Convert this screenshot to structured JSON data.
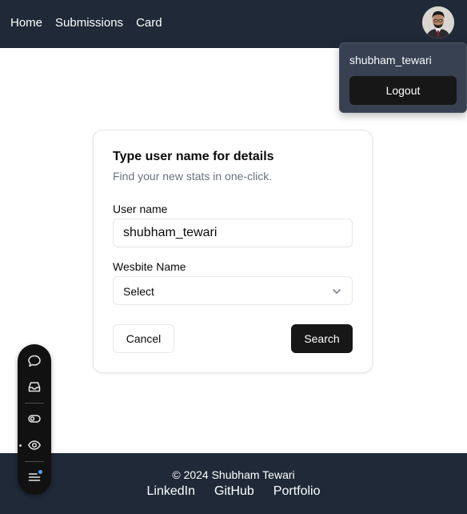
{
  "nav": {
    "links": [
      "Home",
      "Submissions",
      "Card"
    ]
  },
  "user_menu": {
    "username": "shubham_tewari",
    "logout_label": "Logout"
  },
  "card": {
    "title": "Type user name for details",
    "description": "Find your new stats in one-click.",
    "username_label": "User name",
    "username_value": "shubham_tewari",
    "website_label": "Wesbite Name",
    "website_selected": "Select",
    "cancel_label": "Cancel",
    "search_label": "Search"
  },
  "footer": {
    "copyright": "© 2024 Shubham Tewari",
    "links": [
      "LinkedIn",
      "GitHub",
      "Portfolio"
    ]
  },
  "toolbar": {
    "icons": [
      "comment-icon",
      "inbox-icon",
      "toggle-icon",
      "eye-icon",
      "menu-icon"
    ]
  },
  "colors": {
    "navbar_bg": "#1f2937",
    "menu_bg": "#374151",
    "primary_button": "#171717",
    "notification_dot": "#4ea3ff"
  }
}
